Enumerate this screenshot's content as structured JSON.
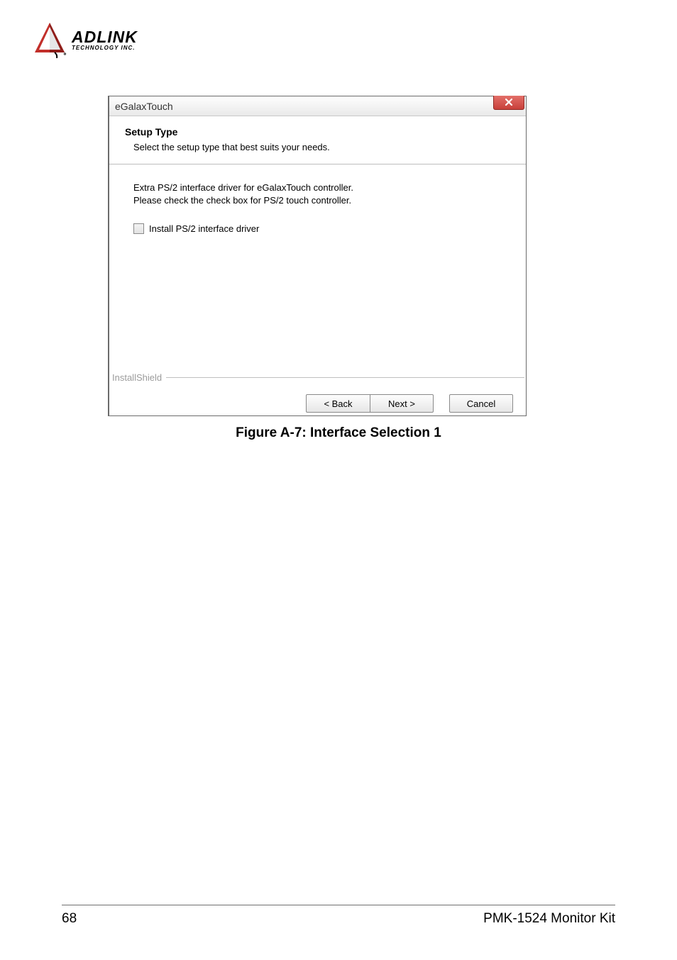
{
  "logo": {
    "main_text": "ADLINK",
    "sub_text": "TECHNOLOGY INC."
  },
  "dialog": {
    "title": "eGalaxTouch",
    "heading": "Setup Type",
    "subheading": "Select the setup type that best suits your needs.",
    "body_line1": "Extra PS/2 interface driver for eGalaxTouch controller.",
    "body_line2": "Please check the check box for PS/2 touch controller.",
    "checkbox_label": "Install PS/2 interface driver",
    "installshield_label": "InstallShield",
    "buttons": {
      "back": "< Back",
      "next": "Next >",
      "cancel": "Cancel"
    }
  },
  "caption": "Figure A-7: Interface Selection 1",
  "footer": {
    "page_number": "68",
    "doc_title": "PMK-1524 Monitor Kit"
  }
}
